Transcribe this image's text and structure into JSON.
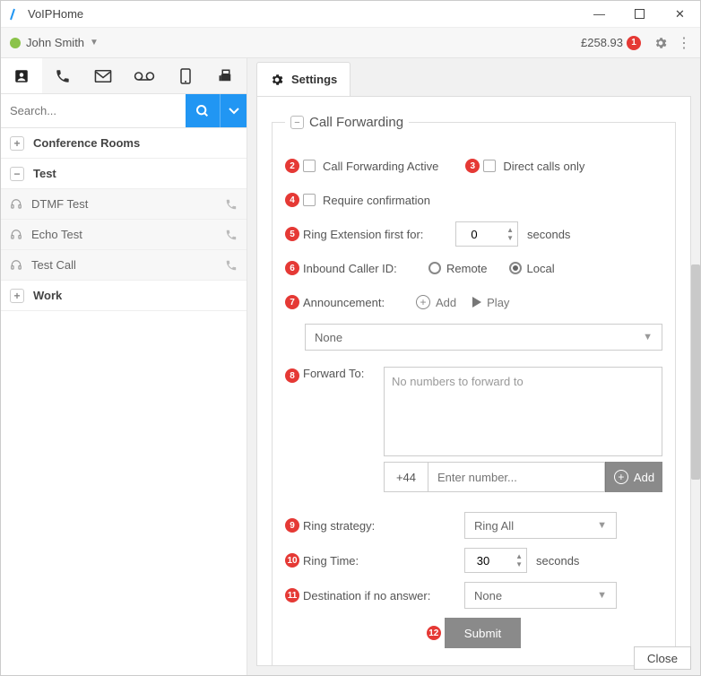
{
  "window": {
    "title": "VoIPHome",
    "minimize": "—",
    "maximize": "▢",
    "close": "✕"
  },
  "header": {
    "user_name": "John Smith",
    "balance": "£258.93"
  },
  "badges": [
    "1",
    "2",
    "3",
    "4",
    "5",
    "6",
    "7",
    "8",
    "9",
    "10",
    "11",
    "12"
  ],
  "search": {
    "placeholder": "Search..."
  },
  "groups": {
    "conf_label": "Conference Rooms",
    "test_label": "Test",
    "work_label": "Work",
    "items": [
      {
        "label": "DTMF Test"
      },
      {
        "label": "Echo Test"
      },
      {
        "label": "Test Call"
      }
    ]
  },
  "settings": {
    "tab_label": "Settings",
    "legend": "Call Forwarding",
    "cf_active_label": "Call Forwarding Active",
    "direct_only_label": "Direct calls only",
    "require_confirm_label": "Require confirmation",
    "ring_ext_label": "Ring Extension first for:",
    "ring_ext_value": "0",
    "seconds": "seconds",
    "inbound_cid_label": "Inbound Caller ID:",
    "remote_label": "Remote",
    "local_label": "Local",
    "announcement_label": "Announcement:",
    "add_label": "Add",
    "play_label": "Play",
    "announcement_value": "None",
    "forward_to_label": "Forward To:",
    "forward_empty": "No numbers to forward to",
    "country_code": "+44",
    "enter_placeholder": "Enter number...",
    "add_btn": "Add",
    "ring_strategy_label": "Ring strategy:",
    "ring_strategy_value": "Ring All",
    "ring_time_label": "Ring Time:",
    "ring_time_value": "30",
    "dest_no_answer_label": "Destination if no answer:",
    "dest_no_answer_value": "None",
    "submit": "Submit"
  },
  "footer": {
    "close": "Close"
  }
}
